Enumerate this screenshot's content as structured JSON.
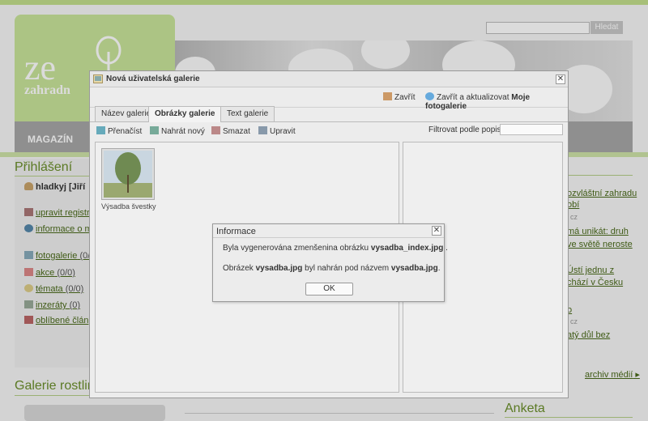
{
  "site": {
    "logo_text": "ze",
    "logo_sub": "zahradn",
    "search_button": "Hledat",
    "nav_item": "MAGAZÍN"
  },
  "left": {
    "login_heading": "Přihlášení",
    "user": "hladkyj [Jiří",
    "links": [
      {
        "label": "upravit registr",
        "count": "",
        "icon": "tools-icon"
      },
      {
        "label": "informace o m",
        "count": "",
        "icon": "info-icon"
      },
      {
        "label": "fotogalerie",
        "count": "(0/",
        "icon": "photo-icon"
      },
      {
        "label": "akce",
        "count": "(0/0)",
        "icon": "calendar-icon"
      },
      {
        "label": "témata",
        "count": "(0/0)",
        "icon": "speech-icon"
      },
      {
        "label": "inzeráty",
        "count": "(0)",
        "icon": "ad-icon"
      },
      {
        "label": "oblíbené člán",
        "count": "",
        "icon": "book-icon"
      }
    ],
    "galerie_heading": "Galerie rostlin"
  },
  "right": {
    "links": [
      "ozvláštní zahradu",
      "obí",
      "má unikát: druh",
      "ve světě neroste",
      "Ústí jednu z",
      "chází v Česku",
      "o",
      "atý důl bez"
    ],
    "cz_labels": [
      "cz",
      "cz"
    ],
    "archiv": "archiv médií",
    "anketa_heading": "Anketa"
  },
  "gallery_window": {
    "title": "Nová uživatelská galerie",
    "close_label": "Zavřít",
    "close_update_prefix": "Zavřít a aktualizovat",
    "close_update_bold": "Moje fotogalerie",
    "tabs": [
      {
        "label": "Název galerie",
        "active": false
      },
      {
        "label": "Obrázky galerie",
        "active": true
      },
      {
        "label": "Text galerie",
        "active": false
      }
    ],
    "toolbar": {
      "reload": "Přenačíst",
      "upload": "Nahrát nový",
      "delete": "Smazat",
      "edit": "Upravit",
      "filter_label": "Filtrovat podle popisu:",
      "filter_value": ""
    },
    "images": [
      {
        "caption": "Výsadba švestky"
      }
    ]
  },
  "dialog": {
    "title": "Informace",
    "line1_prefix": "Byla vygenerována zmenšenina obrázku",
    "line1_bold": "vysadba_index.jpg",
    "line1_suffix": ".",
    "line2_a": "Obrázek",
    "line2_bold1": "vysadba.jpg",
    "line2_b": "byl nahrán pod názvem",
    "line2_bold2": "vysadba.jpg",
    "line2_c": ".",
    "ok": "OK"
  },
  "colors": {
    "accent_green": "#6a8e2a",
    "logo_bg": "#c9e59a"
  }
}
